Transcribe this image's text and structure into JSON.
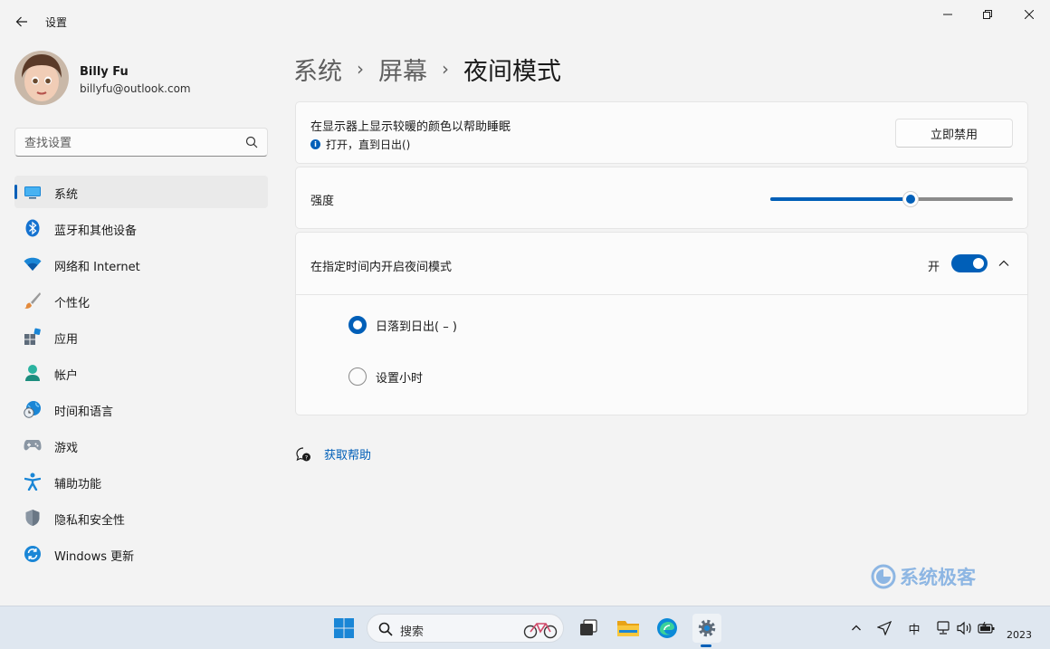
{
  "window": {
    "app_title": "设置"
  },
  "profile": {
    "name": "Billy Fu",
    "email": "billyfu@outlook.com"
  },
  "search": {
    "placeholder": "查找设置"
  },
  "sidebar": {
    "items": [
      {
        "label": "系统",
        "icon": "display-icon",
        "active": true
      },
      {
        "label": "蓝牙和其他设备",
        "icon": "bluetooth-icon",
        "active": false
      },
      {
        "label": "网络和 Internet",
        "icon": "wifi-icon",
        "active": false
      },
      {
        "label": "个性化",
        "icon": "paintbrush-icon",
        "active": false
      },
      {
        "label": "应用",
        "icon": "apps-icon",
        "active": false
      },
      {
        "label": "帐户",
        "icon": "account-icon",
        "active": false
      },
      {
        "label": "时间和语言",
        "icon": "globe-clock-icon",
        "active": false
      },
      {
        "label": "游戏",
        "icon": "gamepad-icon",
        "active": false
      },
      {
        "label": "辅助功能",
        "icon": "accessibility-icon",
        "active": false
      },
      {
        "label": "隐私和安全性",
        "icon": "shield-icon",
        "active": false
      },
      {
        "label": "Windows 更新",
        "icon": "update-icon",
        "active": false
      }
    ]
  },
  "breadcrumb": {
    "items": [
      "系统",
      "屏幕",
      "夜间模式"
    ],
    "separator": "›"
  },
  "night_light": {
    "title": "在显示器上显示较暖的颜色以帮助睡眠",
    "status": "打开，直到日出()",
    "disable_button": "立即禁用",
    "strength_label": "强度",
    "strength_fraction": 0.58,
    "schedule_label": "在指定时间内开启夜间模式",
    "schedule_state": "开",
    "schedule_on": true,
    "options": [
      {
        "label": "日落到日出( – )",
        "checked": true
      },
      {
        "label": "设置小时",
        "checked": false
      }
    ]
  },
  "help": {
    "label": "获取帮助"
  },
  "watermark": {
    "text": "系统极客"
  },
  "taskbar": {
    "search_label": "搜索",
    "tray_ime": "中",
    "time_fragment": "2023"
  },
  "colors": {
    "accent": "#005fb8",
    "background": "#f3f3f3",
    "card": "#fbfbfb",
    "taskbar": "#dfe7f0",
    "watermark": "#8db6e3"
  }
}
